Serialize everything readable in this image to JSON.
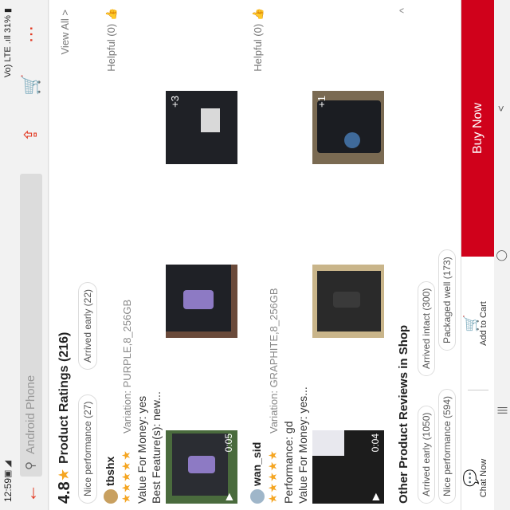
{
  "status": {
    "time": "12:59",
    "icons_left": "▣ ◢",
    "signal": "Vo) LTE .ıll",
    "battery": "31%"
  },
  "topbar": {
    "search_placeholder": "Android Phone"
  },
  "summary": {
    "score": "4.8",
    "title": "Product Ratings (216)",
    "view_all": "View All >",
    "chips": [
      "Nice performance (27)",
      "Arrived early (22)"
    ]
  },
  "reviews": [
    {
      "user": "tbshx",
      "helpful": "Helpful (0)",
      "stars": "★★★★★",
      "variation": "Variation: PURPLE,8_256GB",
      "lines": [
        "Value For Money: yes",
        "Best Feature(s): new..."
      ],
      "thumbs": [
        {
          "duration": "0:05"
        },
        {},
        {
          "more": "+3"
        }
      ]
    },
    {
      "user": "wan_sid",
      "helpful": "Helpful (0)",
      "stars": "★★★★★",
      "variation": "Variation: GRAPHITE,8_256GB",
      "lines": [
        "Performance: gd",
        "Value For Money: yes..."
      ],
      "thumbs": [
        {
          "duration": "0:04"
        },
        {},
        {
          "more": "+1"
        }
      ]
    }
  ],
  "other": {
    "title": "Other Product Reviews in Shop",
    "chips": [
      "Arrived early (1050)",
      "Arrived intact (300)",
      "Nice performance (594)",
      "Packaged well (173)"
    ]
  },
  "bottom": {
    "chat": "Chat Now",
    "cart": "Add to Cart",
    "buy": "Buy Now"
  },
  "colors": {
    "accent": "#e23b24",
    "buy": "#d0011b",
    "star": "#f5a623"
  }
}
